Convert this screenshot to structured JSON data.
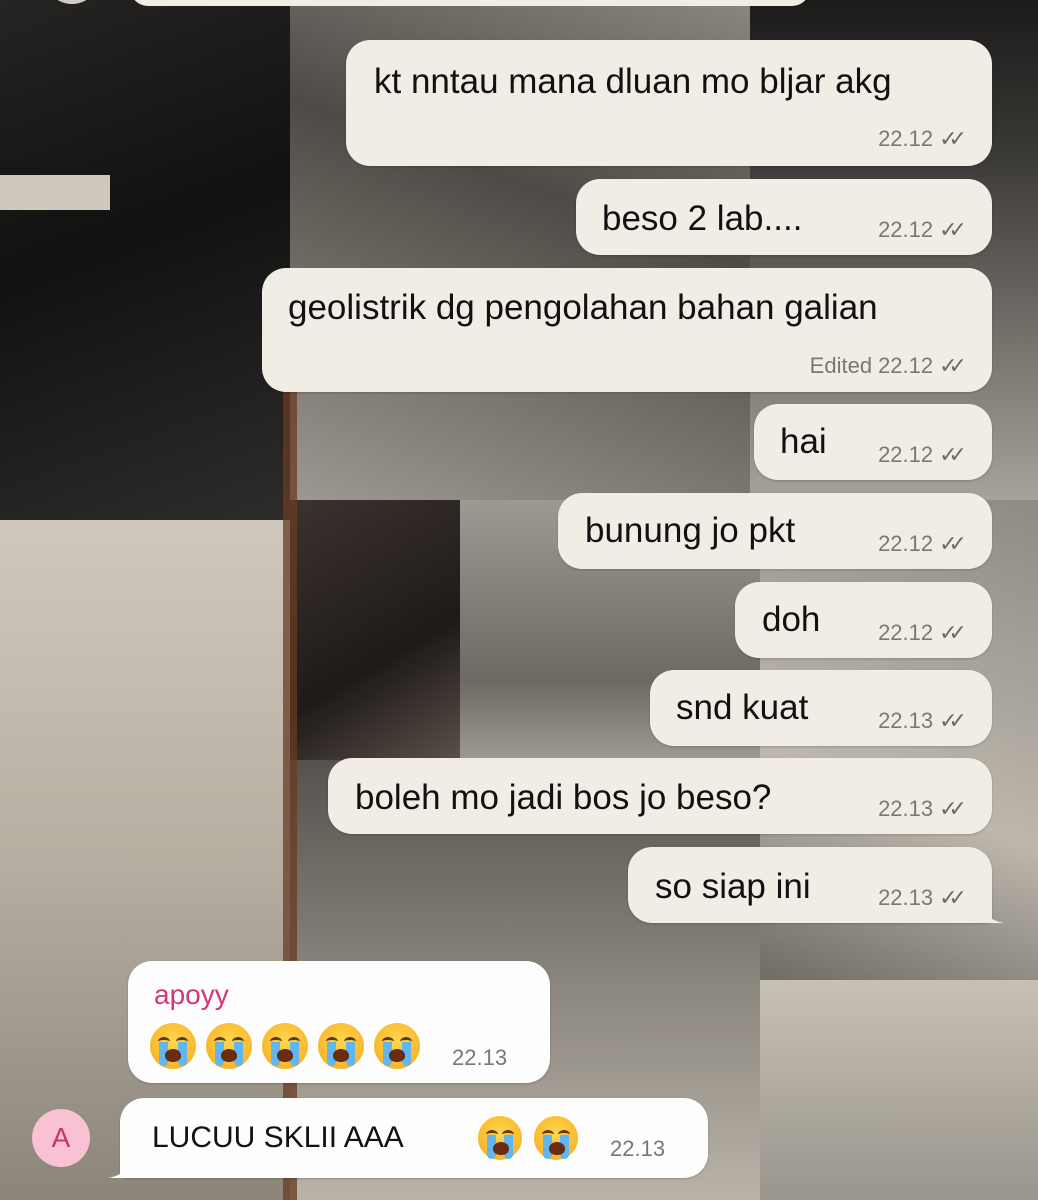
{
  "messages_out": [
    {
      "text": "kt nntau mana dluan mo bljar akg",
      "time": "22.12",
      "edited": ""
    },
    {
      "text": "beso 2 lab....",
      "time": "22.12",
      "edited": ""
    },
    {
      "text": "geolistrik dg pengolahan bahan galian",
      "time": "22.12",
      "edited": "Edited"
    },
    {
      "text": "hai",
      "time": "22.12",
      "edited": ""
    },
    {
      "text": "bunung jo pkt",
      "time": "22.12",
      "edited": ""
    },
    {
      "text": "doh",
      "time": "22.12",
      "edited": ""
    },
    {
      "text": "snd kuat",
      "time": "22.13",
      "edited": ""
    },
    {
      "text": "boleh mo jadi bos jo beso?",
      "time": "22.13",
      "edited": ""
    },
    {
      "text": "so siap ini",
      "time": "22.13",
      "edited": ""
    }
  ],
  "incoming": {
    "sender": "apoyy",
    "first": {
      "emoji": "loudly-crying-face",
      "emoji_count": 5,
      "time": "22.13"
    },
    "second": {
      "text": "LUCUU SKLII AAA",
      "emoji": "loudly-crying-face",
      "emoji_count": 2,
      "time": "22.13"
    },
    "avatar_letter": "A"
  },
  "colors": {
    "outgoing_bubble": "#f1ede5",
    "incoming_bubble": "#fdfdfd",
    "sender_name": "#d4367a",
    "avatar_bg": "#f9c2d4",
    "timestamp": "#7c7870"
  },
  "status_icon": "double-check-read-icon"
}
